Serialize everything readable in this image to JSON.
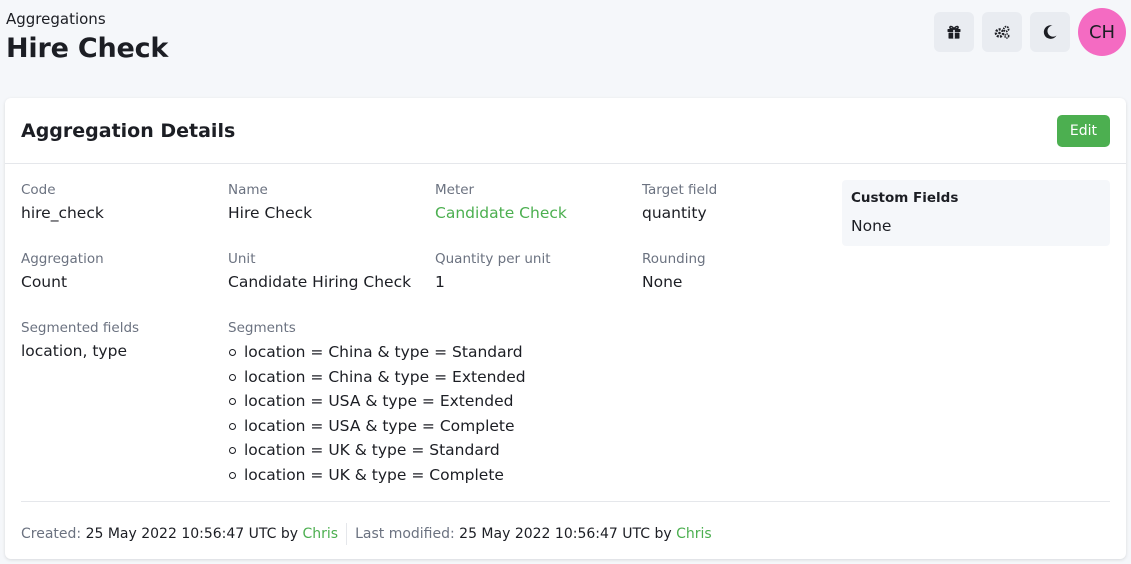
{
  "header": {
    "breadcrumb": "Aggregations",
    "title": "Hire Check",
    "avatar_initials": "CH"
  },
  "icons": {
    "toolbar": [
      "gift-icon",
      "gears-icon",
      "moon-icon"
    ]
  },
  "colors": {
    "accent": "#4caf50",
    "avatar": "#f46bc2"
  },
  "card": {
    "title": "Aggregation Details",
    "edit_label": "Edit",
    "fields": {
      "code": {
        "label": "Code",
        "value": "hire_check"
      },
      "name": {
        "label": "Name",
        "value": "Hire Check"
      },
      "meter": {
        "label": "Meter",
        "value": "Candidate Check"
      },
      "target_field": {
        "label": "Target field",
        "value": "quantity"
      },
      "aggregation": {
        "label": "Aggregation",
        "value": "Count"
      },
      "unit": {
        "label": "Unit",
        "value": "Candidate Hiring Check"
      },
      "quantity_per_unit": {
        "label": "Quantity per unit",
        "value": "1"
      },
      "rounding": {
        "label": "Rounding",
        "value": "None"
      },
      "segmented_fields": {
        "label": "Segmented fields",
        "value": "location, type"
      },
      "segments": {
        "label": "Segments",
        "items": [
          "location = China & type = Standard",
          "location = China & type = Extended",
          "location = USA & type = Extended",
          "location = USA & type = Complete",
          "location = UK & type = Standard",
          "location = UK & type = Complete"
        ]
      }
    },
    "custom_fields": {
      "title": "Custom Fields",
      "value": "None"
    },
    "footer": {
      "created_label": "Created:",
      "created_value": "25 May 2022 10:56:47 UTC",
      "created_by_word": "by",
      "created_by": "Chris",
      "modified_label": "Last modified:",
      "modified_value": "25 May 2022 10:56:47 UTC",
      "modified_by_word": "by",
      "modified_by": "Chris"
    }
  }
}
